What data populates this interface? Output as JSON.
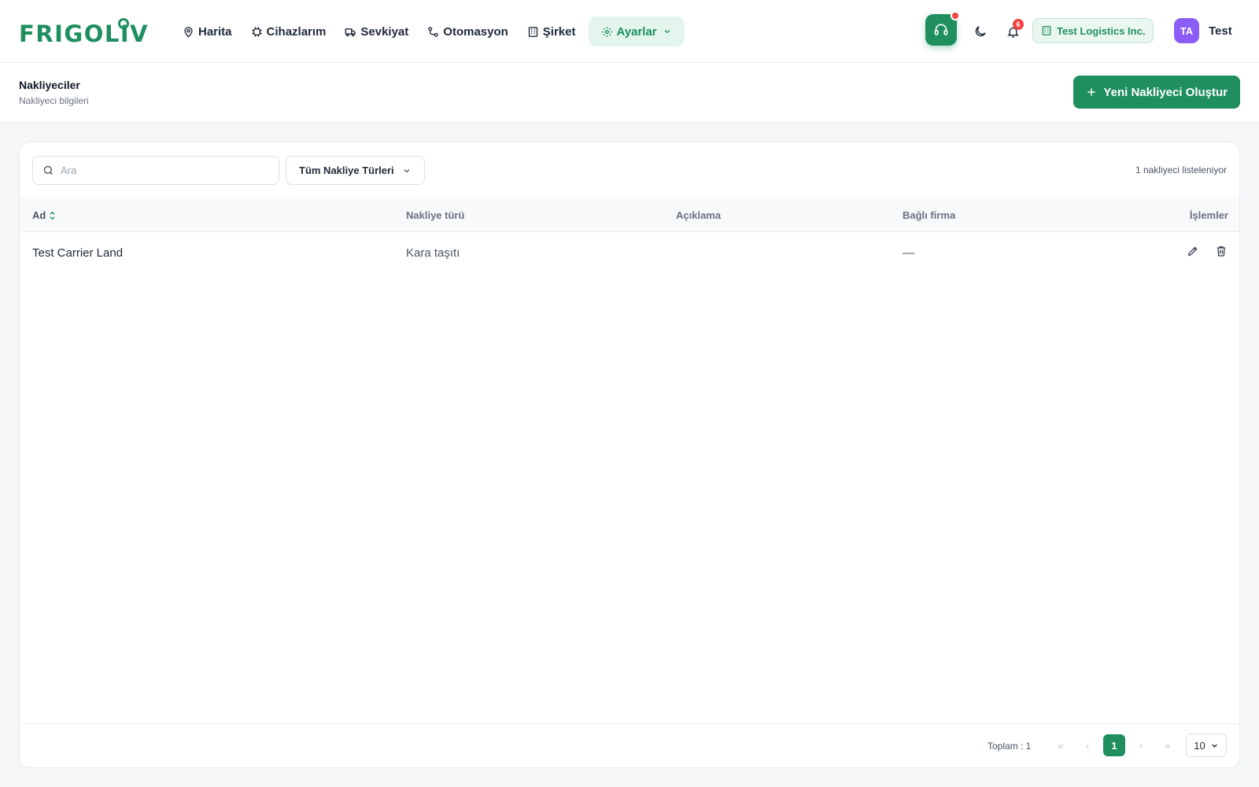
{
  "brand": {
    "logo_text": "FRIGOLIVE",
    "accent_color": "#1f8f5f"
  },
  "nav": {
    "items": [
      {
        "label": "Harita",
        "icon": "map-pin-icon"
      },
      {
        "label": "Cihazlarım",
        "icon": "chip-icon"
      },
      {
        "label": "Sevkiyat",
        "icon": "truck-icon"
      },
      {
        "label": "Otomasyon",
        "icon": "workflow-icon"
      },
      {
        "label": "Şirket",
        "icon": "building-icon"
      }
    ],
    "active": {
      "label": "Ayarlar",
      "icon": "gear-icon"
    }
  },
  "header_tools": {
    "notification_count": "6",
    "company": "Test Logistics Inc.",
    "user_initials": "TA",
    "user_name": "Test"
  },
  "page": {
    "title": "Nakliyeciler",
    "subtitle": "Nakliyeci bilgileri",
    "create_button": "Yeni Nakliyeci Oluştur"
  },
  "toolbar": {
    "search_placeholder": "Ara",
    "filter_label": "Tüm Nakliye Türleri",
    "count_text": "1 nakliyeci listeleniyor"
  },
  "table": {
    "columns": [
      "Ad",
      "Nakliye türü",
      "Açıklama",
      "Bağlı firma",
      "İşlemler"
    ],
    "rows": [
      {
        "name": "Test Carrier Land",
        "type": "Kara taşıtı",
        "description": "",
        "company": "—"
      }
    ]
  },
  "pagination": {
    "total_text": "Toplam : 1",
    "first": "«",
    "prev": "‹",
    "current_page": "1",
    "next": "›",
    "last": "»",
    "page_size": "10"
  }
}
